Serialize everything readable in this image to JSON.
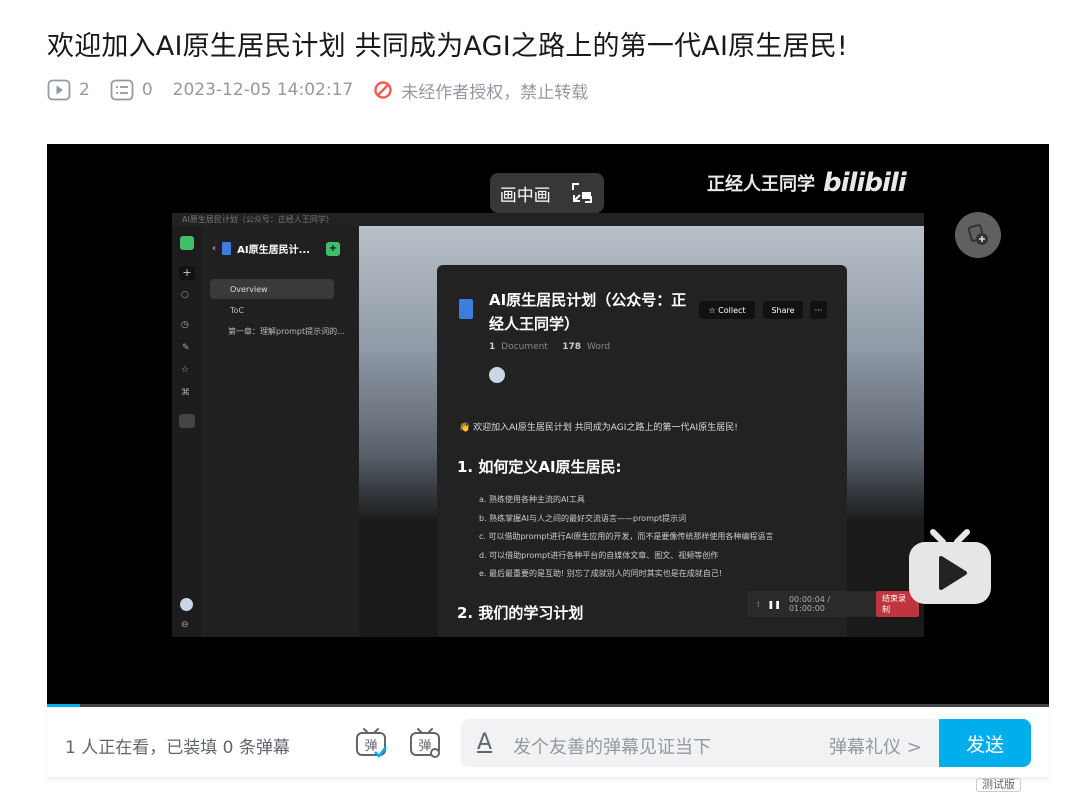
{
  "video": {
    "title": "欢迎加入AI原生居民计划 共同成为AGI之路上的第一代AI原生居民!",
    "plays": "2",
    "danmaku_count": "0",
    "date": "2023-12-05 14:02:17",
    "copyright": "未经作者授权，禁止转载"
  },
  "player": {
    "pip_label": "画中画",
    "watermark_text": "正经人王同学",
    "watermark_logo": "bilibili",
    "progress_fraction": 0.033,
    "inner": {
      "window_title": "AI原生居民计划（公众号：正经人王同学）",
      "sidebar_header": "AI原生居民计...",
      "sidebar_overview": "Overview",
      "sidebar_toc": "ToC",
      "sidebar_chapter": "第一章：理解prompt提示词的...",
      "doc_title": "AI原生居民计划（公众号：正经人王同学）",
      "collect": "Collect",
      "share": "Share",
      "doc_count": "1",
      "doc_label": "Document",
      "word_count": "178",
      "word_label": "Word",
      "intro": "欢迎加入AI原生居民计划 共同成为AGI之路上的第一代AI原生居民!",
      "heading1": "1. 如何定义AI原生居民:",
      "list": [
        "a. 熟练使用各种主流的AI工具",
        "b. 熟练掌握AI与人之间的最好交流语言——prompt提示词",
        "c. 可以借助prompt进行AI原生应用的开发，而不是要像传统那样使用各种编程语言",
        "d. 可以借助prompt进行各种平台的自媒体文章、图文、视频等创作",
        "e. 最后最重要的是互助! 别忘了成就别人的同时其实也是在成就自己!"
      ],
      "heading2": "2. 我们的学习计划",
      "rec_time": "00:00:04 / 01:00:00",
      "rec_end": "结束录制"
    }
  },
  "bottom": {
    "viewers": "1 人正在看，已装填 0 条弹幕",
    "input_placeholder": "发个友善的弹幕见证当下",
    "etiquette": "弹幕礼仪 >",
    "send": "发送",
    "beta": "测试版"
  },
  "colors": {
    "accent": "#00aeec",
    "warn": "#f85a54"
  }
}
